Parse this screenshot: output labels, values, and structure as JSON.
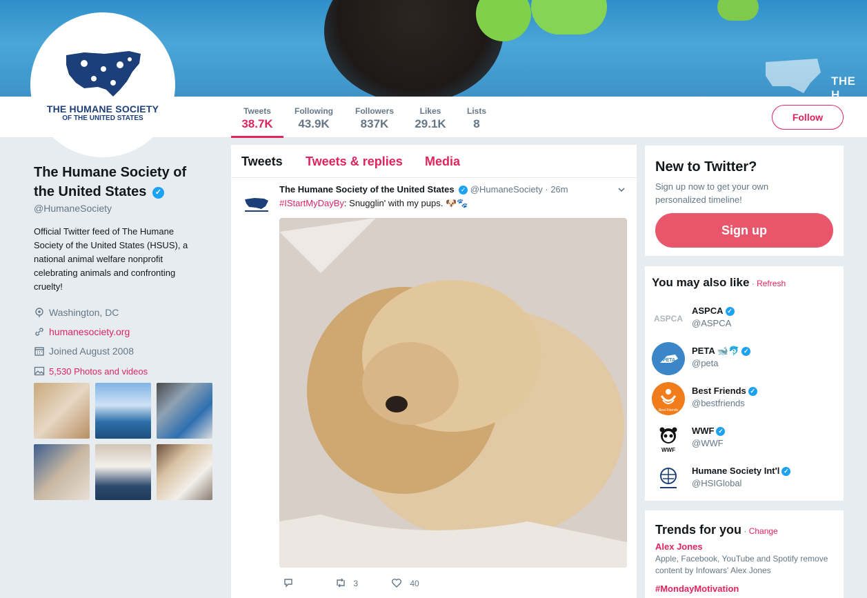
{
  "profile": {
    "name": "The Humane Society of the United States",
    "name_line1": "The Humane Society of",
    "name_line2": "the United States",
    "handle": "@HumaneSociety",
    "bio": "Official Twitter feed of The Humane Society of the United States (HSUS), a national animal welfare nonprofit celebrating animals and confronting cruelty!",
    "location": "Washington, DC",
    "website": "humanesociety.org",
    "joined": "Joined August 2008",
    "photos_videos": "5,530 Photos and videos",
    "avatar_line1": "THE HUMANE SOCIETY",
    "avatar_line2": "OF THE UNITED STATES"
  },
  "banner": {
    "text": "THE H"
  },
  "stats": [
    {
      "label": "Tweets",
      "value": "38.7K",
      "active": true
    },
    {
      "label": "Following",
      "value": "43.9K"
    },
    {
      "label": "Followers",
      "value": "837K"
    },
    {
      "label": "Likes",
      "value": "29.1K"
    },
    {
      "label": "Lists",
      "value": "8"
    }
  ],
  "follow_label": "Follow",
  "timeline": {
    "tabs": [
      "Tweets",
      "Tweets & replies",
      "Media"
    ],
    "tweet": {
      "author": "The Humane Society of the United States",
      "handle": "@HumaneSociety",
      "time": "· 26m",
      "hashtag": "#IStartMyDayBy",
      "text": ": Snugglin' with my pups.",
      "emoji": "🐶🐾",
      "retweets": "3",
      "likes": "40"
    }
  },
  "new_to_twitter": {
    "title": "New to Twitter?",
    "text": "Sign up now to get your own personalized timeline!",
    "button": "Sign up"
  },
  "suggestions": {
    "title": "You may also like",
    "sep": " · ",
    "refresh": "Refresh",
    "items": [
      {
        "name": "ASPCA",
        "handle": "@ASPCA",
        "extra": ""
      },
      {
        "name": "PETA",
        "handle": "@peta",
        "extra": "🐋🐬"
      },
      {
        "name": "Best Friends",
        "handle": "@bestfriends",
        "extra": ""
      },
      {
        "name": "WWF",
        "handle": "@WWF",
        "extra": ""
      },
      {
        "name": "Humane Society Int'l",
        "handle": "@HSIGlobal",
        "extra": ""
      }
    ],
    "avatar_texts": {
      "aspca": "ASPCA",
      "peta": "PETA",
      "bestfriends": "Best Friends",
      "wwf": "WWF"
    }
  },
  "trends": {
    "title": "Trends for you",
    "sep": " · ",
    "change": "Change",
    "items": [
      {
        "name": "Alex Jones",
        "desc": "Apple, Facebook, YouTube and Spotify remove content by Infowars' Alex Jones"
      },
      {
        "name": "#MondayMotivation",
        "desc": ""
      }
    ]
  },
  "colors": {
    "accent": "#e0245e",
    "verified": "#1da1f2",
    "signup": "#e8566b",
    "hsus_blue": "#1c3f7a"
  }
}
